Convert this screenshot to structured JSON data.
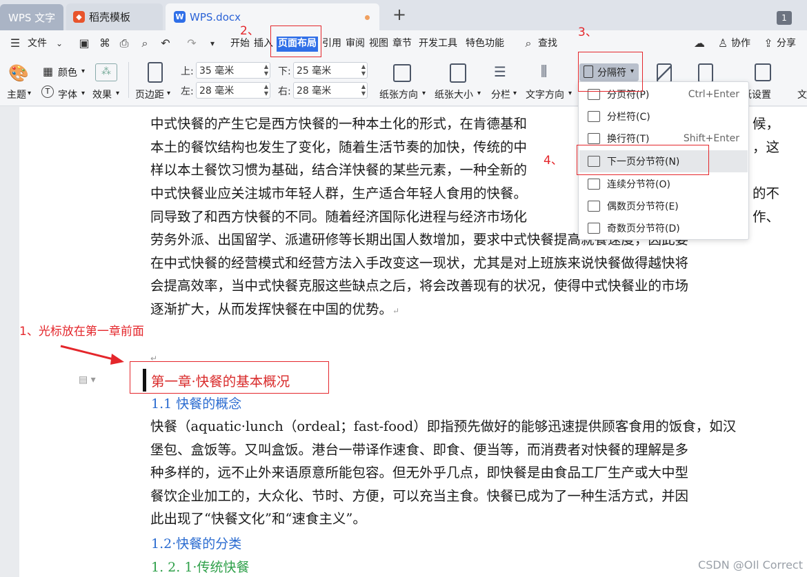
{
  "tabs": {
    "wps_app": "WPS 文字",
    "template": "稻壳模板",
    "document": "WPS.docx",
    "new_tab": "+",
    "window_count": "1"
  },
  "menubar": {
    "file": "文件",
    "items": [
      "开始",
      "插入",
      "页面布局",
      "引用",
      "审阅",
      "视图",
      "章节",
      "开发工具",
      "特色功能"
    ],
    "search": "查找",
    "collaborate": "协作",
    "share": "分享"
  },
  "ribbon": {
    "theme": "主题",
    "color": "颜色",
    "font": "字体",
    "effect": "效果",
    "margins": "页边距",
    "top_label": "上:",
    "top_value": "35 毫米",
    "bottom_label": "下:",
    "bottom_value": "25 毫米",
    "left_label": "左:",
    "left_value": "28 毫米",
    "right_label": "右:",
    "right_value": "28 毫米",
    "orientation": "纸张方向",
    "size": "纸张大小",
    "columns": "分栏",
    "text_direction": "文字方向",
    "breaks": "分隔符",
    "page_setup": "稿纸设置",
    "more": "文"
  },
  "dropdown": {
    "items": [
      {
        "label": "分页符(P)",
        "shortcut": "Ctrl+Enter"
      },
      {
        "label": "分栏符(C)",
        "shortcut": ""
      },
      {
        "label": "换行符(T)",
        "shortcut": "Shift+Enter"
      },
      {
        "label": "下一页分节符(N)",
        "shortcut": ""
      },
      {
        "label": "连续分节符(O)",
        "shortcut": ""
      },
      {
        "label": "偶数页分节符(E)",
        "shortcut": ""
      },
      {
        "label": "奇数页分节符(D)",
        "shortcut": ""
      }
    ]
  },
  "document": {
    "p1_l1": "中式快餐的产生它是西方快餐的一种本土化的形式，在肯德基和",
    "p1_l1_end": "候，",
    "p1_l2": "本土的餐饮结构也发生了变化，随着生活节奏的加快，传统的中",
    "p1_l2_end": "，这",
    "p1_l3": "样以本土餐饮习惯为基础，结合洋快餐的某些元素，一种全新的",
    "p2_l1": "中式快餐业应关注城市年轻人群，生产适合年轻人食用的快餐。",
    "p2_l1_end": "的不",
    "p2_l2": "同导致了和西方快餐的不同。随着经济国际化进程与经济市场化",
    "p2_l2_end": "作、",
    "p2_l3": "劳务外派、出国留学、派遣研修等长期出国人数增加，要求中式快餐提高就餐速度，因此要",
    "p2_l4": "在中式快餐的经营模式和经营方法入手改变这一现状，尤其是对上班族来说快餐做得越快将",
    "p2_l5": "会提高效率，当中式快餐克服这些缺点之后，将会改善现有的状况，使得中式快餐业的市场",
    "p2_l6": "逐渐扩大，从而发挥快餐在中国的优势。",
    "chapter": "第一章·快餐的基本概况",
    "h_1_1": "1.1 快餐的概念",
    "p3_l1": "快餐（aquatic·lunch（ordeal；fast-food）即指预先做好的能够迅速提供顾客食用的饭食，如汉",
    "p3_l2": "堡包、盒饭等。又叫盒饭。港台一带译作速食、即食、便当等，而消费者对快餐的理解是多",
    "p3_l3": "种多样的，远不止外来语原意所能包容。但无外乎几点，即快餐是由食品工厂生产或大中型",
    "p3_l4": "餐饮企业加工的，大众化、节时、方便，可以充当主食。快餐已成为了一种生活方式，并因",
    "p3_l5": "此出现了“快餐文化”和“速食主义”。",
    "h_1_2": "1.2·快餐的分类",
    "h_1_2_1": "1. 2. 1·传统快餐"
  },
  "annotations": {
    "step1": "1、光标放在第一章前面",
    "step2": "2、",
    "step3": "3、",
    "step4": "4、"
  },
  "watermark": "CSDN @OIl Correct",
  "colors": {
    "accent": "#2f6fe8",
    "annotation": "#e4262b",
    "heading1": "#d92a2a",
    "heading2": "#2a6bd0",
    "heading3": "#2fa04a"
  }
}
